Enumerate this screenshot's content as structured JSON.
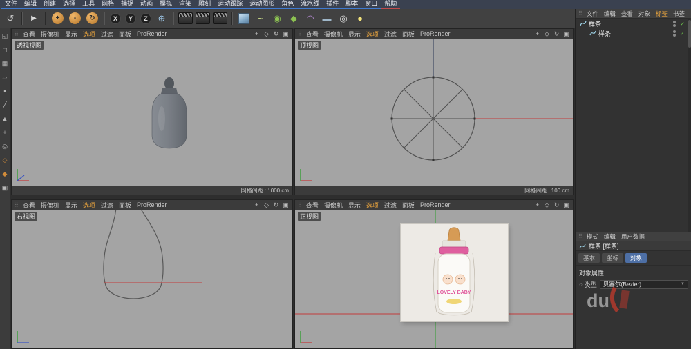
{
  "menubar": {
    "items": [
      {
        "label": "文件"
      },
      {
        "label": "编辑"
      },
      {
        "label": "创建"
      },
      {
        "label": "选择"
      },
      {
        "label": "工具"
      },
      {
        "label": "网格"
      },
      {
        "label": "捕捉"
      },
      {
        "label": "动画"
      },
      {
        "label": "模拟"
      },
      {
        "label": "渲染"
      },
      {
        "label": "雕刻"
      },
      {
        "label": "运动跟踪"
      },
      {
        "label": "运动图形"
      },
      {
        "label": "角色"
      },
      {
        "label": "流水线"
      },
      {
        "label": "插件"
      },
      {
        "label": "脚本"
      },
      {
        "label": "窗口"
      },
      {
        "label": "帮助"
      }
    ]
  },
  "toolbar": {
    "icons": [
      {
        "name": "undo-icon",
        "glyph": "↺",
        "color": "#c8c8c8"
      },
      {
        "name": "toolbar-separator",
        "glyph": "",
        "cls": "sep",
        "inter": false
      },
      {
        "name": "live-selection-icon",
        "glyph": "▶",
        "color": "#d8d8d8",
        "cls": "small"
      },
      {
        "name": "toolbar-separator",
        "glyph": "",
        "cls": "sep",
        "inter": false
      },
      {
        "name": "move-tool-icon",
        "glyph": "+",
        "cls": "ball"
      },
      {
        "name": "scale-tool-icon",
        "glyph": "▫",
        "cls": "ball"
      },
      {
        "name": "rotate-tool-icon",
        "glyph": "↻",
        "cls": "ball"
      },
      {
        "name": "toolbar-separator",
        "glyph": "",
        "cls": "sep",
        "inter": false
      },
      {
        "name": "x-axis-lock-button",
        "glyph": "X",
        "cls": "axis"
      },
      {
        "name": "y-axis-lock-button",
        "glyph": "Y",
        "cls": "axis"
      },
      {
        "name": "z-axis-lock-button",
        "glyph": "Z",
        "cls": "axis"
      },
      {
        "name": "coordinate-system-icon",
        "glyph": "⊕",
        "color": "#9ec7e8"
      },
      {
        "name": "toolbar-separator",
        "glyph": "",
        "cls": "sep",
        "inter": false
      },
      {
        "name": "render-view-icon",
        "glyph": "",
        "cls": "clapper"
      },
      {
        "name": "render-picture-viewer-icon",
        "glyph": "",
        "cls": "clapper"
      },
      {
        "name": "render-settings-icon",
        "glyph": "",
        "cls": "clapper"
      },
      {
        "name": "toolbar-separator",
        "glyph": "",
        "cls": "sep",
        "inter": false
      },
      {
        "name": "add-cube-icon",
        "glyph": "",
        "cls": "cube"
      },
      {
        "name": "spline-pen-icon",
        "glyph": "~",
        "color": "#cfe08a"
      },
      {
        "name": "subdivision-surface-icon",
        "glyph": "◉",
        "color": "#8cc152"
      },
      {
        "name": "sweep-object-icon",
        "glyph": "◆",
        "color": "#8cc152"
      },
      {
        "name": "deformer-icon",
        "glyph": "◠",
        "color": "#b78bd4"
      },
      {
        "name": "floor-object-icon",
        "glyph": "▬",
        "color": "#9fb7c9"
      },
      {
        "name": "camera-object-icon",
        "glyph": "◎",
        "color": "#d8d8d8"
      },
      {
        "name": "light-object-icon",
        "glyph": "●",
        "color": "#f2e27a"
      }
    ]
  },
  "leftbar": {
    "icons": [
      {
        "name": "make-editable-icon",
        "glyph": "◱",
        "color": "#b8b8b8"
      },
      {
        "name": "model-mode-icon",
        "glyph": "◻",
        "color": "#b8b8b8"
      },
      {
        "name": "texture-mode-icon",
        "glyph": "▦",
        "color": "#b8b8b8"
      },
      {
        "name": "workplane-mode-icon",
        "glyph": "▱",
        "color": "#b8b8b8"
      },
      {
        "name": "points-mode-icon",
        "glyph": "▪",
        "color": "#b8b8b8"
      },
      {
        "name": "edges-mode-icon",
        "glyph": "╱",
        "color": "#b8b8b8"
      },
      {
        "name": "polygons-mode-icon",
        "glyph": "▲",
        "color": "#b8b8b8"
      },
      {
        "name": "enable-axis-icon",
        "glyph": "+",
        "color": "#b8b8b8"
      },
      {
        "name": "viewport-solo-icon",
        "glyph": "◎",
        "color": "#b8b8b8"
      },
      {
        "name": "snap-enable-icon",
        "glyph": "◇",
        "color": "#d08b3a"
      },
      {
        "name": "quantize-icon",
        "glyph": "◆",
        "color": "#d08b3a"
      },
      {
        "name": "lock-icon",
        "glyph": "▣",
        "color": "#b8b8b8"
      }
    ]
  },
  "glyphs": {
    "grip": "⠿",
    "check": "✓",
    "caret_down": "▼",
    "circle": "○"
  },
  "viewport_menu": {
    "items": [
      {
        "label": "查看"
      },
      {
        "label": "摄像机"
      },
      {
        "label": "显示"
      },
      {
        "label": "选项",
        "cls": "hl"
      },
      {
        "label": "过滤"
      },
      {
        "label": "面板"
      },
      {
        "label": "ProRender"
      }
    ]
  },
  "viewport_icons": {
    "items": [
      {
        "name": "pan-view-icon",
        "glyph": "+"
      },
      {
        "name": "zoom-view-icon",
        "glyph": "◇"
      },
      {
        "name": "rotate-view-icon",
        "glyph": "↻"
      },
      {
        "name": "toggle-view-icon",
        "glyph": "▣"
      }
    ]
  },
  "viewports": {
    "perspective": {
      "label": "透视视图",
      "grid_info": "网格间距 : 1000 cm"
    },
    "top": {
      "label": "顶视图",
      "grid_info": "网格间距 : 100 cm"
    },
    "right": {
      "label": "右视图"
    },
    "front": {
      "label": "正视图"
    }
  },
  "front_image": {
    "brand_text": "LOVELY BABY"
  },
  "object_manager": {
    "menu": [
      {
        "label": "文件"
      },
      {
        "label": "编辑"
      },
      {
        "label": "查看"
      },
      {
        "label": "对象"
      },
      {
        "label": "标签",
        "cls": "hl"
      },
      {
        "label": "书签"
      }
    ],
    "objects": [
      {
        "label": "样条",
        "cls": "lvl0"
      },
      {
        "label": "样条",
        "cls": "lvl1"
      }
    ]
  },
  "attributes": {
    "menu": [
      {
        "label": "模式"
      },
      {
        "label": "编辑"
      },
      {
        "label": "用户数据"
      }
    ],
    "title": "样条 [样条]",
    "tabs": [
      {
        "label": "基本"
      },
      {
        "label": "坐标"
      },
      {
        "label": "对象",
        "cls": "active"
      }
    ],
    "section": "对象属性",
    "rows": [
      {
        "label": "类型",
        "value": "贝塞尔(Bezier)"
      }
    ]
  },
  "watermark": {
    "text": "du"
  },
  "colors": {
    "accent_orange": "#e8a33d",
    "axis_red": "#c23b3b",
    "axis_green": "#2f9e2f",
    "axis_blue": "#3b55c2",
    "tab_active": "#4d6fa5"
  }
}
